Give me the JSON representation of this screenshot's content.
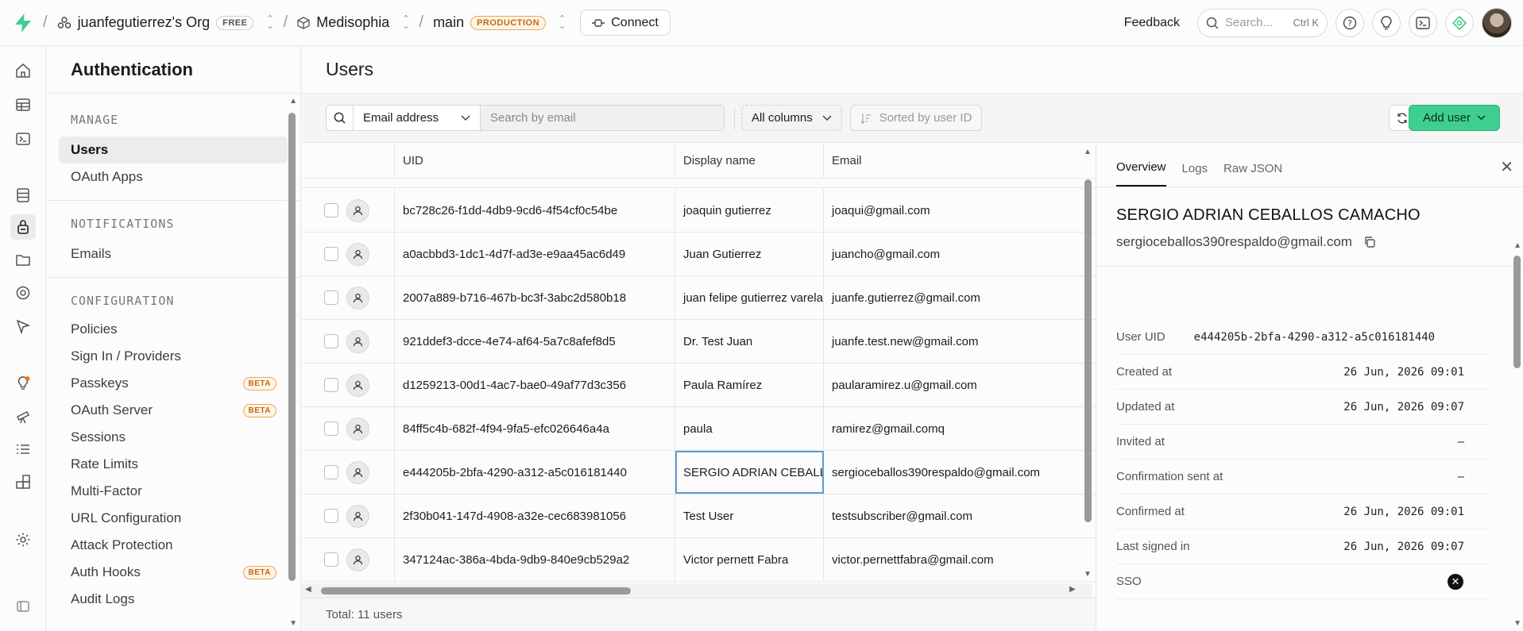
{
  "topbar": {
    "org": "juanfegutierrez's Org",
    "org_badge": "FREE",
    "project": "Medisophia",
    "branch": "main",
    "branch_badge": "PRODUCTION",
    "connect_label": "Connect",
    "feedback_label": "Feedback",
    "search_placeholder": "Search...",
    "search_shortcut": "Ctrl K"
  },
  "sidebar": {
    "title": "Authentication",
    "sections": [
      {
        "heading": "MANAGE",
        "items": [
          {
            "label": "Users",
            "active": true
          },
          {
            "label": "OAuth Apps"
          }
        ]
      },
      {
        "heading": "NOTIFICATIONS",
        "items": [
          {
            "label": "Emails"
          }
        ]
      },
      {
        "heading": "CONFIGURATION",
        "items": [
          {
            "label": "Policies"
          },
          {
            "label": "Sign In / Providers"
          },
          {
            "label": "Passkeys",
            "badge": "BETA"
          },
          {
            "label": "OAuth Server",
            "badge": "BETA"
          },
          {
            "label": "Sessions"
          },
          {
            "label": "Rate Limits"
          },
          {
            "label": "Multi-Factor"
          },
          {
            "label": "URL Configuration"
          },
          {
            "label": "Attack Protection"
          },
          {
            "label": "Auth Hooks",
            "badge": "BETA"
          },
          {
            "label": "Audit Logs"
          }
        ]
      }
    ]
  },
  "main": {
    "title": "Users",
    "toolbar": {
      "filter_field": "Email address",
      "search_placeholder": "Search by email",
      "columns_label": "All columns",
      "sort_label": "Sorted by user ID",
      "add_user_label": "Add user"
    },
    "table": {
      "columns": [
        "UID",
        "Display name",
        "Email"
      ],
      "rows": [
        {
          "uid": "bc728c26-f1dd-4db9-9cd6-4f54cf0c54be",
          "name": "joaquin gutierrez",
          "email": "joaqui@gmail.com"
        },
        {
          "uid": "a0acbbd3-1dc1-4d7f-ad3e-e9aa45ac6d49",
          "name": "Juan Gutierrez",
          "email": "juancho@gmail.com"
        },
        {
          "uid": "2007a889-b716-467b-bc3f-3abc2d580b18",
          "name": "juan felipe gutierrez varela",
          "email": "juanfe.gutierrez@gmail.com"
        },
        {
          "uid": "921ddef3-dcce-4e74-af64-5a7c8afef8d5",
          "name": "Dr. Test Juan",
          "email": "juanfe.test.new@gmail.com"
        },
        {
          "uid": "d1259213-00d1-4ac7-bae0-49af77d3c356",
          "name": "Paula Ramírez",
          "email": "paularamirez.u@gmail.com"
        },
        {
          "uid": "84ff5c4b-682f-4f94-9fa5-efc026646a4a",
          "name": "paula",
          "email": "ramirez@gmail.comq"
        },
        {
          "uid": "e444205b-2bfa-4290-a312-a5c016181440",
          "name": "SERGIO ADRIAN CEBALLOS CAMACHO",
          "email": "sergioceballos390respaldo@gmail.com"
        },
        {
          "uid": "2f30b041-147d-4908-a32e-cec683981056",
          "name": "Test User",
          "email": "testsubscriber@gmail.com"
        },
        {
          "uid": "347124ac-386a-4bda-9db9-840e9cb529a2",
          "name": "Victor pernett Fabra",
          "email": "victor.pernettfabra@gmail.com"
        }
      ],
      "focused_row": 6
    },
    "footer": "Total: 11 users"
  },
  "detail": {
    "tabs": [
      "Overview",
      "Logs",
      "Raw JSON"
    ],
    "active_tab": "Overview",
    "name": "SERGIO ADRIAN CEBALLOS CAMACHO",
    "email": "sergioceballos390respaldo@gmail.com",
    "fields": [
      {
        "label": "User UID",
        "value": "e444205b-2bfa-4290-a312-a5c016181440"
      },
      {
        "label": "Created at",
        "value": "26 Jun, 2026 09:01"
      },
      {
        "label": "Updated at",
        "value": "26 Jun, 2026 09:07"
      },
      {
        "label": "Invited at",
        "value": "–"
      },
      {
        "label": "Confirmation sent at",
        "value": "–"
      },
      {
        "label": "Confirmed at",
        "value": "26 Jun, 2026 09:01"
      },
      {
        "label": "Last signed in",
        "value": "26 Jun, 2026 09:07"
      },
      {
        "label": "SSO",
        "value": ""
      }
    ]
  },
  "colors": {
    "accent_green": "#3ecf8e",
    "beta_orange": "#c46a11",
    "focus_blue": "#5b9bd5"
  }
}
